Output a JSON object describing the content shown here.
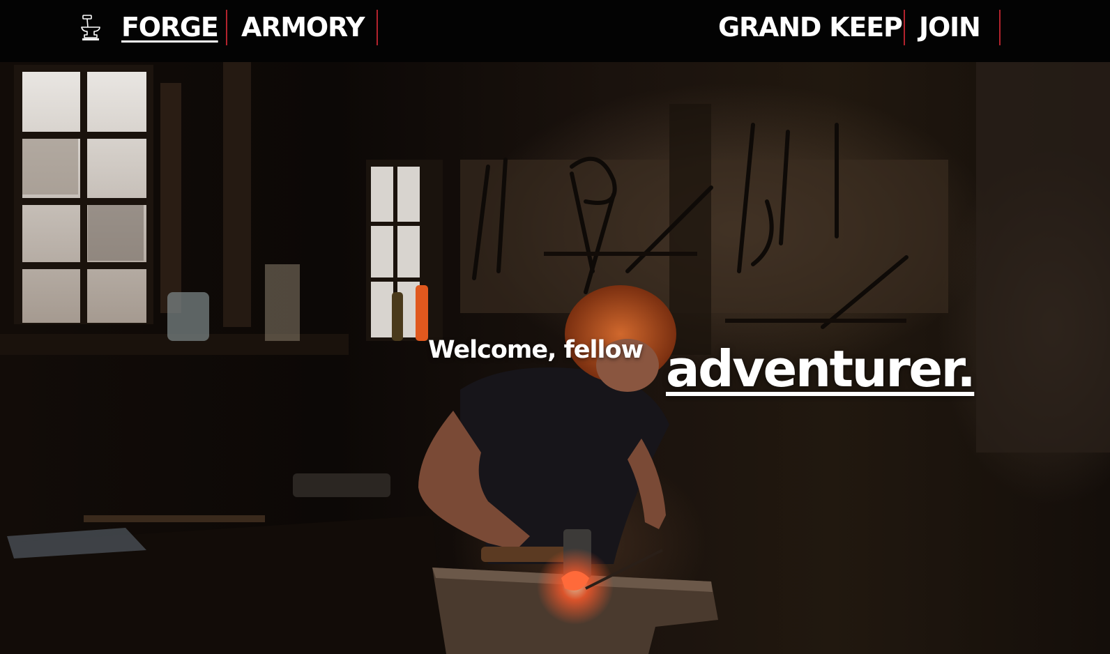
{
  "nav": {
    "left": [
      {
        "label": "FORGE",
        "active": true
      },
      {
        "label": "ARMORY",
        "active": false
      }
    ],
    "right": [
      {
        "label": "GRAND KEEP",
        "active": false
      },
      {
        "label": "JOIN",
        "active": false
      }
    ],
    "logo_icon": "anvil-hammer-icon"
  },
  "hero": {
    "welcome": "Welcome, fellow",
    "highlight": "adventurer.",
    "image": "blacksmith-workshop-photo"
  },
  "colors": {
    "nav_background": "#030303",
    "divider": "#b3232d",
    "text": "#ffffff",
    "glow": "#ff5a2a"
  }
}
